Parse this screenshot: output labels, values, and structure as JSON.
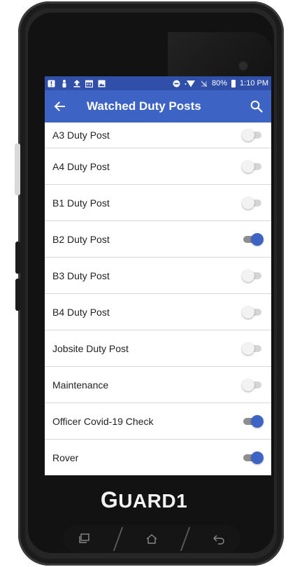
{
  "colors": {
    "status_bar": "#2f4fa8",
    "app_bar": "#3d63c4",
    "toggle_on": "#3d63c4",
    "toggle_off": "#d5d5d5",
    "device": "#262626"
  },
  "status_bar": {
    "left_icons": [
      "alert-icon",
      "person-icon",
      "upload-icon",
      "calendar-icon",
      "image-icon"
    ],
    "right_icons": [
      "do-not-disturb-icon",
      "wifi-icon",
      "no-sim-icon",
      "battery-icon"
    ],
    "battery": "80%",
    "time": "1:10 PM"
  },
  "app_bar": {
    "title": "Watched Duty Posts",
    "back_icon": "arrow-left-icon",
    "search_icon": "search-icon"
  },
  "duty_posts": [
    {
      "label": "A3 Duty Post",
      "watched": false
    },
    {
      "label": "A4 Duty Post",
      "watched": false
    },
    {
      "label": "B1 Duty Post",
      "watched": false
    },
    {
      "label": "B2 Duty Post",
      "watched": true
    },
    {
      "label": "B3 Duty Post",
      "watched": false
    },
    {
      "label": "B4 Duty Post",
      "watched": false
    },
    {
      "label": "Jobsite Duty Post",
      "watched": false
    },
    {
      "label": "Maintenance",
      "watched": false
    },
    {
      "label": "Officer Covid-19 Check",
      "watched": true
    },
    {
      "label": "Rover",
      "watched": true
    }
  ],
  "device": {
    "brand_lead": "G",
    "brand_rest": "UARD1",
    "nav_keys": [
      "recent-apps-icon",
      "home-icon",
      "back-icon"
    ]
  }
}
